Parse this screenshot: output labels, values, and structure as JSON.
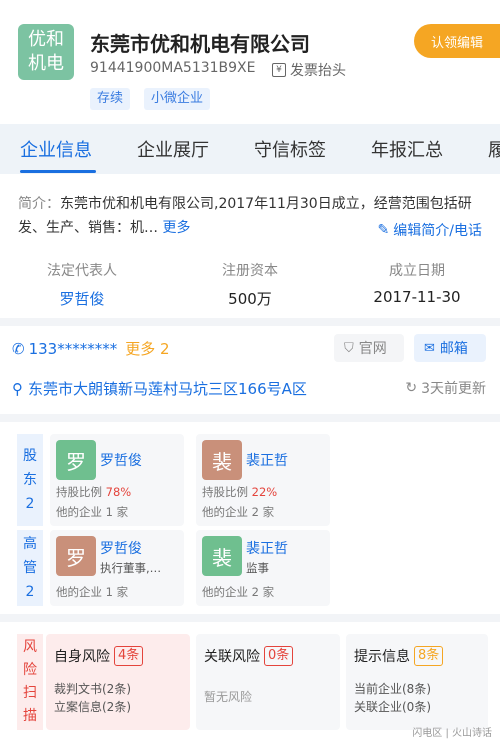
{
  "company": {
    "logo_line1": "优和",
    "logo_line2": "机电",
    "name": "东莞市优和机电有限公司",
    "credit_code": "91441900MA5131B9XE",
    "invoice_label": "发票抬头",
    "claim_label": "认领编辑",
    "tags": [
      "存续",
      "小微企业"
    ]
  },
  "tabs": [
    "企业信息",
    "企业展厅",
    "守信标签",
    "年报汇总",
    "履"
  ],
  "intro": {
    "label": "简介：",
    "text": "东莞市优和机电有限公司,2017年11月30日成立，经营范围包括研发、生产、销售：机…",
    "more": "更多",
    "edit_label": "编辑简介/电话"
  },
  "stats": {
    "legal_label": "法定代表人",
    "legal_value": "罗哲俊",
    "capital_label": "注册资本",
    "capital_value": "500万",
    "date_label": "成立日期",
    "date_value": "2017-11-30"
  },
  "contact": {
    "phone": "133********",
    "phone_more": "更多 2",
    "website": "官网",
    "email": "邮箱",
    "address": "东莞市大朗镇新马莲村马坑三区166号A区",
    "updated": "3天前更新"
  },
  "shareholders": {
    "side": [
      "股",
      "东",
      "2"
    ],
    "items": [
      {
        "avatar": "罗",
        "avatar_color": "#6fbf8f",
        "name": "罗哲俊",
        "ratio_label": "持股比例",
        "ratio": "78%",
        "companies": "他的企业  1 家"
      },
      {
        "avatar": "裴",
        "avatar_color": "#c9907a",
        "name": "裴正哲",
        "ratio_label": "持股比例",
        "ratio": "22%",
        "companies": "他的企业  2 家"
      }
    ]
  },
  "executives": {
    "side": [
      "高",
      "管",
      "2"
    ],
    "items": [
      {
        "avatar": "罗",
        "avatar_color": "#c9907a",
        "name": "罗哲俊",
        "position": "执行董事,…",
        "companies": "他的企业  1 家"
      },
      {
        "avatar": "裴",
        "avatar_color": "#6fbf8f",
        "name": "裴正哲",
        "position": "监事",
        "companies": "他的企业  2 家"
      }
    ]
  },
  "risk": {
    "side": [
      "风",
      "险",
      "扫",
      "描"
    ],
    "self": {
      "title": "自身风险",
      "count": "4条",
      "lines": [
        "裁判文书(2条)",
        "立案信息(2条)"
      ]
    },
    "related": {
      "title": "关联风险",
      "count": "0条",
      "lines": [
        "暂无风险"
      ]
    },
    "notice": {
      "title": "提示信息",
      "count": "8条",
      "lines": [
        "当前企业(8条)",
        "关联企业(0条)"
      ]
    }
  },
  "watermark": "闪电区 | 火山诗话"
}
